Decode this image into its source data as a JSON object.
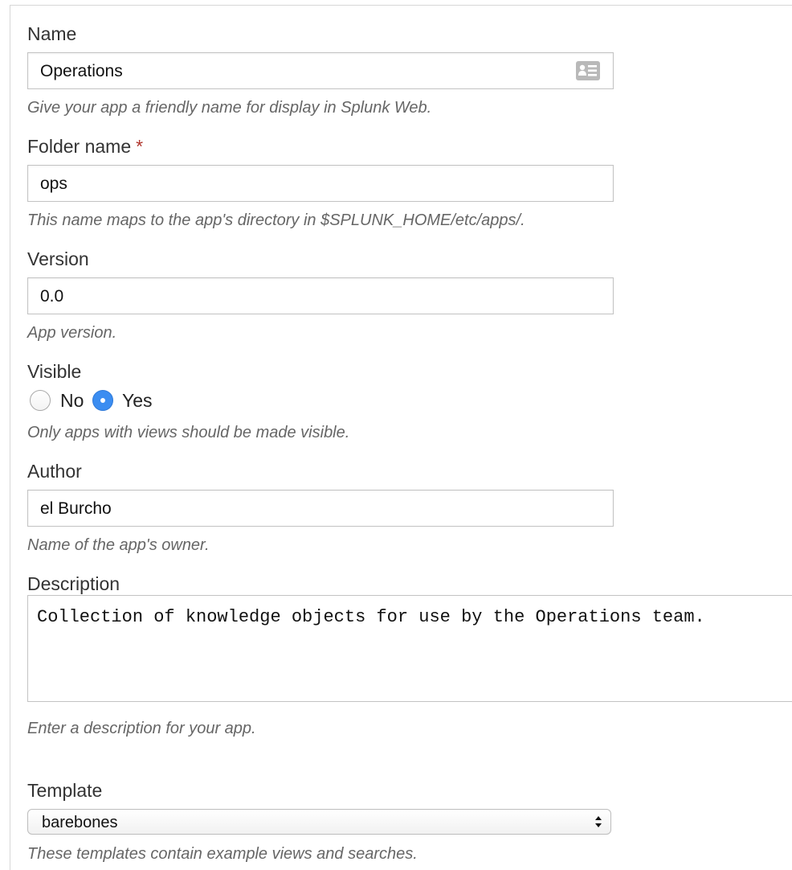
{
  "name": {
    "label": "Name",
    "value": "Operations",
    "help": "Give your app a friendly name for display in Splunk Web.",
    "icon": "contact-card-icon"
  },
  "folder": {
    "label": "Folder name",
    "required_marker": "*",
    "value": "ops",
    "help": "This name maps to the app's directory in $SPLUNK_HOME/etc/apps/."
  },
  "version": {
    "label": "Version",
    "value": "0.0",
    "help": "App version."
  },
  "visible": {
    "label": "Visible",
    "options": [
      "No",
      "Yes"
    ],
    "selected": "Yes",
    "help": "Only apps with views should be made visible."
  },
  "author": {
    "label": "Author",
    "value": "el Burcho",
    "help": "Name of the app's owner."
  },
  "description": {
    "label": "Description",
    "value": "Collection of knowledge objects for use by the Operations team.",
    "help": "Enter a description for your app."
  },
  "template": {
    "label": "Template",
    "value": "barebones",
    "help": "These templates contain example views and searches."
  },
  "colors": {
    "radio_selected": "#3b8df1",
    "required": "#b0362d",
    "help_text": "#666666"
  }
}
